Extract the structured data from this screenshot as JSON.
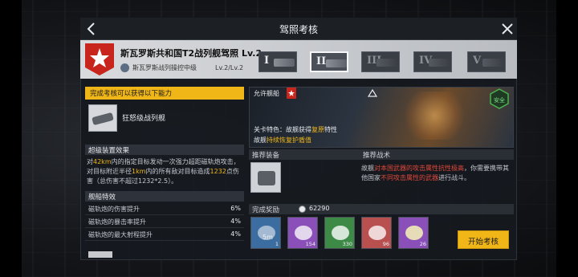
{
  "window": {
    "title": "驾照考核"
  },
  "header": {
    "license_name": "斯瓦罗斯共和国T2战列舰驾照 Lv.2",
    "rank": "斯瓦罗斯战列操控中级",
    "level": "Lv.2/Lv.2",
    "tiers": [
      "I",
      "II",
      "III",
      "IV",
      "V"
    ]
  },
  "left": {
    "ability_tag": "完成考核可以获得以下能力",
    "ship_name": "狂怒级战列舰",
    "skill_title": "超级装置效果",
    "skill_desc_parts": [
      "对",
      "42km",
      "内的指定目标发动一次强力超距磁轨炮攻击，对目标附近半径",
      "1km",
      "内的所有敌对目标造成",
      "1232",
      "点伤害（总伤害不超过1232*2.5）。"
    ],
    "traits_title": "舰船特效",
    "traits": [
      {
        "label": "磁轨炮的伤害提升",
        "value": "6%"
      },
      {
        "label": "磁轨炮的暴击率提升",
        "value": "4%"
      },
      {
        "label": "磁轨炮的最大射程提升",
        "value": "4%"
      }
    ]
  },
  "banner": {
    "allow_label": "允许舰船",
    "safe_label": "安全",
    "level_trait_prefix": "关卡特色：故舰获得",
    "level_trait_hl": "复原",
    "level_trait_suffix": "特性",
    "level_trait2_prefix": "故舰",
    "level_trait2_hl": "持续恢复护盾值"
  },
  "recommend": {
    "equip_title": "推荐装备",
    "tactic_title": "推荐战术",
    "tactic_parts": [
      "故舰",
      "对本国武器的攻击属性抗性极高",
      "，你需要携带其他国家",
      "不同攻击属性的武器",
      "进行战斗。"
    ]
  },
  "rewards": {
    "title": "完成奖励",
    "credits": "62290",
    "items": [
      {
        "count": "1",
        "color": "#3b6da0",
        "icon": "speed-module-icon",
        "label": "5m"
      },
      {
        "count": "154",
        "color": "#8a4fb8",
        "icon": "ore-icon"
      },
      {
        "count": "330",
        "color": "#3d8a47",
        "icon": "ore-icon"
      },
      {
        "count": "96",
        "color": "#b85050",
        "icon": "ore-icon"
      },
      {
        "count": "26",
        "color": "#8a4fb8",
        "icon": "ore-icon"
      }
    ]
  },
  "actions": {
    "start_label": "开始考核"
  },
  "colors": {
    "accent": "#f0b618",
    "panel": "#16191e",
    "header": "#d8dadd",
    "danger": "#e0473a"
  }
}
